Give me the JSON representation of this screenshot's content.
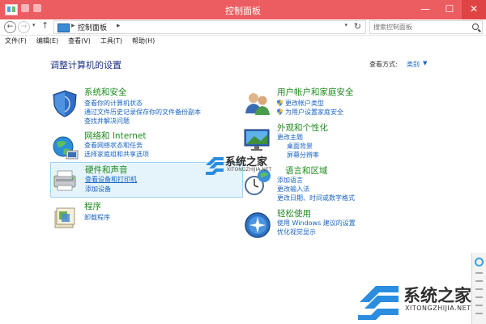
{
  "window": {
    "title": "控制面板",
    "controls": {
      "minimize": "—",
      "maximize": "☐",
      "close": "✕"
    }
  },
  "address": {
    "back": "←",
    "forward": "→",
    "up": "↑",
    "breadcrumb": "控制面板",
    "separator": "▸",
    "refresh": "↻",
    "search_placeholder": "搜索控制面板"
  },
  "menu": [
    "文件(F)",
    "编辑(E)",
    "查看(V)",
    "工具(T)",
    "帮助(H)"
  ],
  "page": {
    "title": "调整计算机的设置",
    "view_by_label": "查看方式:",
    "view_by_value": "类别"
  },
  "categories_left": [
    {
      "heading": "系统和安全",
      "icon": "system-security-icon",
      "links": [
        "查看你的计算机状态",
        "通过文件历史记录保存你的文件备份副本",
        "查找并解决问题"
      ]
    },
    {
      "heading": "网络和 Internet",
      "icon": "network-internet-icon",
      "links": [
        "查看网络状态和任务",
        "选择家庭组和共享选项"
      ]
    },
    {
      "heading": "硬件和声音",
      "icon": "hardware-sound-icon",
      "links": [
        "查看设备和打印机",
        "添加设备"
      ]
    },
    {
      "heading": "程序",
      "icon": "programs-icon",
      "links": [
        "卸载程序"
      ]
    }
  ],
  "categories_right": [
    {
      "heading": "用户帐户和家庭安全",
      "icon": "user-accounts-icon",
      "links": [
        "更改帐户类型",
        "为用户设置家庭安全"
      ]
    },
    {
      "heading": "外观和个性化",
      "icon": "appearance-icon",
      "links": [
        "更改主题",
        "桌面背景",
        "屏幕分辨率"
      ]
    },
    {
      "heading": "语言和区域",
      "icon": "clock-language-icon",
      "links": [
        "添加语言",
        "更改输入法",
        "更改日期、时间或数字格式"
      ]
    },
    {
      "heading": "轻松使用",
      "icon": "ease-of-access-icon",
      "links": [
        "使用 Windows 建议的设置",
        "优化视觉显示"
      ]
    }
  ],
  "watermarks": {
    "small_text": "系统之家",
    "small_url": "XITONGZHIJIA.NET",
    "large_text": "系统之家",
    "large_url": "XITONGZHIJIA.NET"
  },
  "colors": {
    "titlebar": "#eb5d60",
    "heading_green": "#1e8a1e",
    "link_blue": "#1a64c6",
    "page_title": "#1e3287",
    "highlight": "#e5f3fb"
  }
}
